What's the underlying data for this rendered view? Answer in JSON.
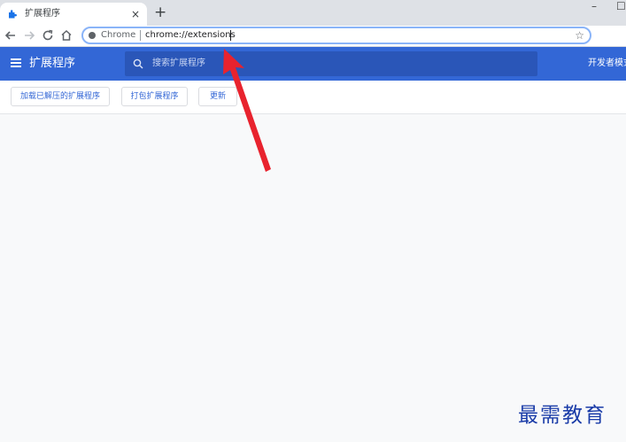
{
  "browser": {
    "tab": {
      "title": "扩展程序",
      "close_glyph": "×"
    },
    "new_tab_glyph": "+",
    "window_controls": {
      "minimize": "–",
      "maximize": "☐"
    },
    "omnibox": {
      "site_label": "Chrome",
      "url": "chrome://extensions",
      "star_glyph": "☆"
    },
    "icons": [
      "back-icon",
      "forward-icon",
      "reload-icon",
      "home-icon",
      "star-icon"
    ]
  },
  "extensions_page": {
    "header": {
      "title": "扩展程序",
      "search_placeholder": "搜索扩展程序",
      "developer_mode_label": "开发者模式"
    },
    "actions": {
      "load_unpacked": "加载已解压的扩展程序",
      "pack_extension": "打包扩展程序",
      "update": "更新"
    }
  },
  "watermark": {
    "text": "最需教育"
  },
  "colors": {
    "header_bg": "#3367d6",
    "search_bg": "#2a56b8",
    "arrow": "#e8232e",
    "watermark": "#1a3ca8"
  }
}
